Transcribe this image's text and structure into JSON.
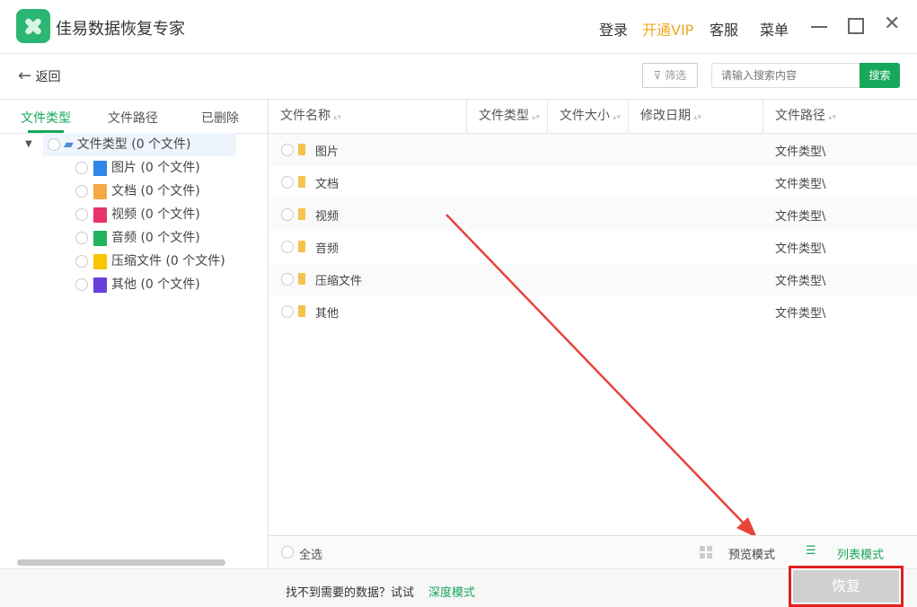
{
  "app": {
    "title": "佳易数据恢复专家"
  },
  "topmenu": {
    "login": "登录",
    "vip": "开通VIP",
    "service": "客服",
    "menu": "菜单"
  },
  "toolbar": {
    "back": "返回",
    "filter": "筛选",
    "search_placeholder": "请输入搜索内容",
    "search_button": "搜索"
  },
  "sidebar": {
    "tabs": [
      "文件类型",
      "文件路径",
      "已删除"
    ],
    "root": "文件类型 (0 个文件)",
    "items": [
      {
        "label": "图片 (0 个文件)",
        "color": "#2e86e8"
      },
      {
        "label": "文档 (0 个文件)",
        "color": "#f5a742"
      },
      {
        "label": "视频 (0 个文件)",
        "color": "#e9336b"
      },
      {
        "label": "音频 (0 个文件)",
        "color": "#22b35e"
      },
      {
        "label": "压缩文件 (0 个文件)",
        "color": "#f7c600"
      },
      {
        "label": "其他 (0 个文件)",
        "color": "#6a3fdc"
      }
    ]
  },
  "table": {
    "columns": [
      "文件名称",
      "文件类型",
      "文件大小",
      "修改日期",
      "文件路径"
    ],
    "rows": [
      {
        "name": "图片",
        "path": "文件类型\\"
      },
      {
        "name": "文档",
        "path": "文件类型\\"
      },
      {
        "name": "视频",
        "path": "文件类型\\"
      },
      {
        "name": "音频",
        "path": "文件类型\\"
      },
      {
        "name": "压缩文件",
        "path": "文件类型\\"
      },
      {
        "name": "其他",
        "path": "文件类型\\"
      }
    ]
  },
  "footer": {
    "select_all": "全选",
    "preview_mode": "预览模式",
    "list_mode": "列表模式",
    "hint": "找不到需要的数据？试试",
    "deep_mode": "深度模式",
    "recover": "恢复"
  },
  "colors": {
    "accent": "#17a85b",
    "vip": "#f0a81e",
    "highlight": "#e02020"
  }
}
